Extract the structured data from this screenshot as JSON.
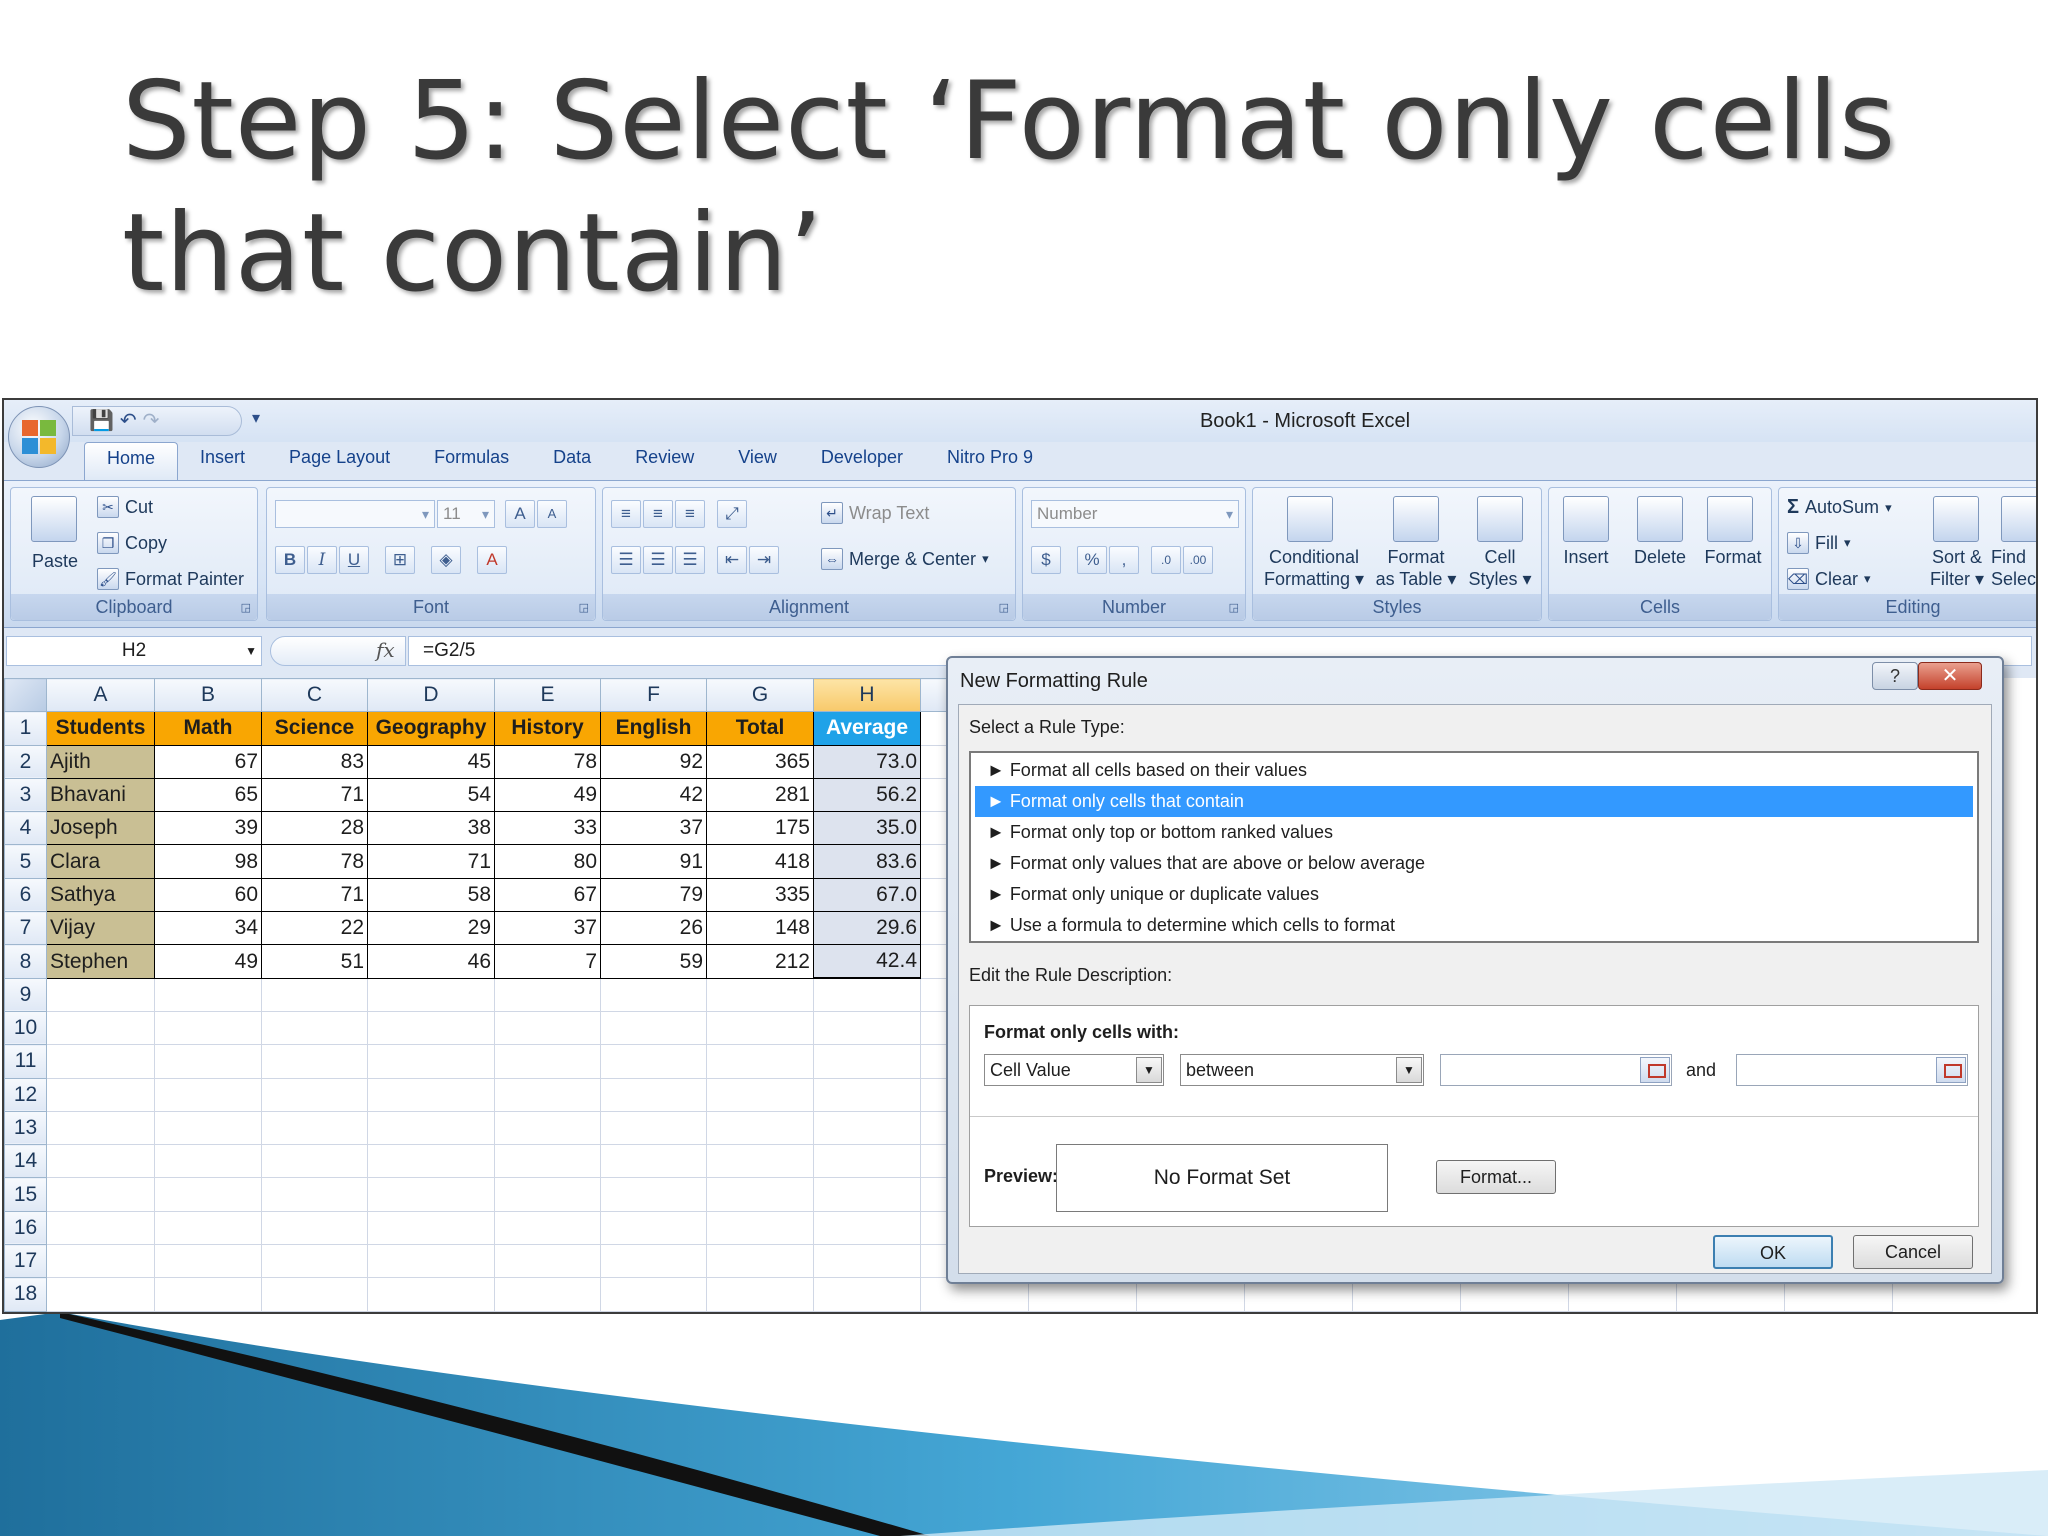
{
  "slide": {
    "title_line1": "Step 5: Select ‘Format only cells",
    "title_line2": "that contain’"
  },
  "window": {
    "title": "Book1 - Microsoft Excel"
  },
  "tabs": [
    "Home",
    "Insert",
    "Page Layout",
    "Formulas",
    "Data",
    "Review",
    "View",
    "Developer",
    "Nitro Pro 9"
  ],
  "ribbon": {
    "clipboard": {
      "label": "Clipboard",
      "paste": "Paste",
      "cut": "Cut",
      "copy": "Copy",
      "format_painter": "Format Painter"
    },
    "font": {
      "label": "Font",
      "size": "11",
      "bold": "B",
      "italic": "I",
      "underline": "U"
    },
    "alignment": {
      "label": "Alignment",
      "wrap_text": "Wrap Text",
      "merge_center": "Merge & Center"
    },
    "number": {
      "label": "Number",
      "format": "Number",
      "percent": "%",
      "comma": ","
    },
    "styles": {
      "label": "Styles",
      "conditional_1": "Conditional",
      "conditional_2": "Formatting",
      "format_table_1": "Format",
      "format_table_2": "as Table",
      "cell_styles_1": "Cell",
      "cell_styles_2": "Styles"
    },
    "cells": {
      "label": "Cells",
      "insert": "Insert",
      "delete": "Delete",
      "format": "Format"
    },
    "editing": {
      "label": "Editing",
      "autosum": "AutoSum",
      "fill": "Fill",
      "clear": "Clear",
      "sort_1": "Sort &",
      "sort_2": "Filter",
      "find_1": "Find",
      "find_2": "Selec"
    }
  },
  "formula_bar": {
    "name_box": "H2",
    "fx": "fx",
    "formula": "=G2/5"
  },
  "sheet": {
    "columns": [
      "A",
      "B",
      "C",
      "D",
      "E",
      "F",
      "G",
      "H"
    ],
    "header_row": [
      "Students",
      "Math",
      "Science",
      "Geography",
      "History",
      "English",
      "Total",
      "Average"
    ],
    "rows": [
      [
        "Ajith",
        "67",
        "83",
        "45",
        "78",
        "92",
        "365",
        "73.0"
      ],
      [
        "Bhavani",
        "65",
        "71",
        "54",
        "49",
        "42",
        "281",
        "56.2"
      ],
      [
        "Joseph",
        "39",
        "28",
        "38",
        "33",
        "37",
        "175",
        "35.0"
      ],
      [
        "Clara",
        "98",
        "78",
        "71",
        "80",
        "91",
        "418",
        "83.6"
      ],
      [
        "Sathya",
        "60",
        "71",
        "58",
        "67",
        "79",
        "335",
        "67.0"
      ],
      [
        "Vijay",
        "34",
        "22",
        "29",
        "37",
        "26",
        "148",
        "29.6"
      ],
      [
        "Stephen",
        "49",
        "51",
        "46",
        "7",
        "59",
        "212",
        "42.4"
      ]
    ],
    "row_numbers": [
      "1",
      "2",
      "3",
      "4",
      "5",
      "6",
      "7",
      "8",
      "9",
      "10",
      "11",
      "12",
      "13",
      "14",
      "15",
      "16",
      "17",
      "18"
    ]
  },
  "dialog": {
    "title": "New Formatting Rule",
    "help": "?",
    "close": "✕",
    "select_rule_type": "Select a Rule Type:",
    "rule_types": [
      "► Format all cells based on their values",
      "► Format only cells that contain",
      "► Format only top or bottom ranked values",
      "► Format only values that are above or below average",
      "► Format only unique or duplicate values",
      "► Use a formula to determine which cells to format"
    ],
    "edit_description": "Edit the Rule Description:",
    "format_only_with": "Format only cells with:",
    "condition_field": "Cell Value",
    "operator": "between",
    "and_label": "and",
    "preview_label": "Preview:",
    "preview_text": "No Format Set",
    "format_button": "Format...",
    "ok": "OK",
    "cancel": "Cancel"
  }
}
